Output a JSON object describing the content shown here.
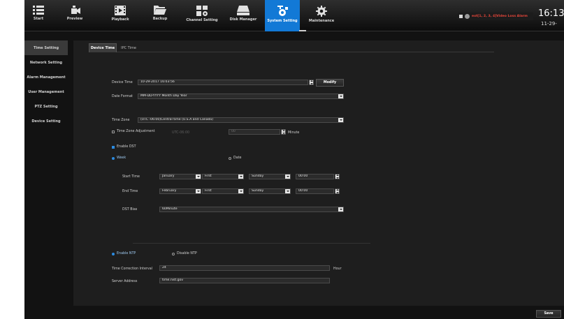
{
  "toolbar": {
    "items": [
      {
        "label": "Start",
        "icon": "start-menu-icon"
      },
      {
        "label": "Preview",
        "icon": "preview-icon"
      },
      {
        "label": "Playback",
        "icon": "playback-icon"
      },
      {
        "label": "Backup",
        "icon": "backup-folder-icon"
      },
      {
        "label": "Channel Setting",
        "icon": "channel-setting-icon"
      },
      {
        "label": "Disk Manager",
        "icon": "disk-manager-icon"
      },
      {
        "label": "System Setting",
        "icon": "system-setting-icon"
      },
      {
        "label": "Maintenance",
        "icon": "maintenance-gear-icon"
      }
    ],
    "active": "System Setting",
    "accent_color": "#1279d6"
  },
  "alarm": {
    "text": "ext[1, 2, 3, 4]Video Loss Alarm",
    "color": "#e8463a"
  },
  "clock": {
    "time": "16:13",
    "date": "11-29-"
  },
  "sidebar": {
    "items": [
      "Time Setting",
      "Network Setting",
      "Alarm Management",
      "User Management",
      "PTZ Setting",
      "Device Setting"
    ],
    "active": "Time Setting"
  },
  "tabs": {
    "device_time": "Device Time",
    "ipc_time": "IPC Time"
  },
  "form": {
    "device_time_label": "Device Time",
    "device_time_value": "10-29-2017 16:03:56",
    "modify_button": "Modify",
    "date_format_label": "Date Format",
    "date_format_value": "MM-DD-YYYY Month Day Year",
    "time_zone_label": "Time Zone",
    "time_zone_value": "(UTC -06:00)Central time (U.S.A and Canada)",
    "tz_adjust_label": "Time Zone Adjustment",
    "tz_adjust_value": "UTC-06:00",
    "tz_minute_value": "00",
    "minute_label": "Minute",
    "enable_dst_label": "Enable DST",
    "week_label": "Week",
    "date_label": "Date",
    "start_time_label": "Start Time",
    "start_month": "January",
    "start_week": "First",
    "start_day": "Sunday",
    "start_hour": "00:00",
    "end_time_label": "End Time",
    "end_month": "February",
    "end_week": "First",
    "end_day": "Sunday",
    "end_hour": "00:00",
    "dst_bias_label": "DST Bias",
    "dst_bias_value": "60Minute",
    "enable_ntp_label": "Enable NTP",
    "disable_ntp_label": "Disable NTP",
    "ntp_interval_label": "Time Correction Interval",
    "ntp_interval_value": "24",
    "hour_label": "Hour",
    "server_address_label": "Server Address",
    "server_address_value": "time.nist.gov",
    "save_button": "Save"
  }
}
